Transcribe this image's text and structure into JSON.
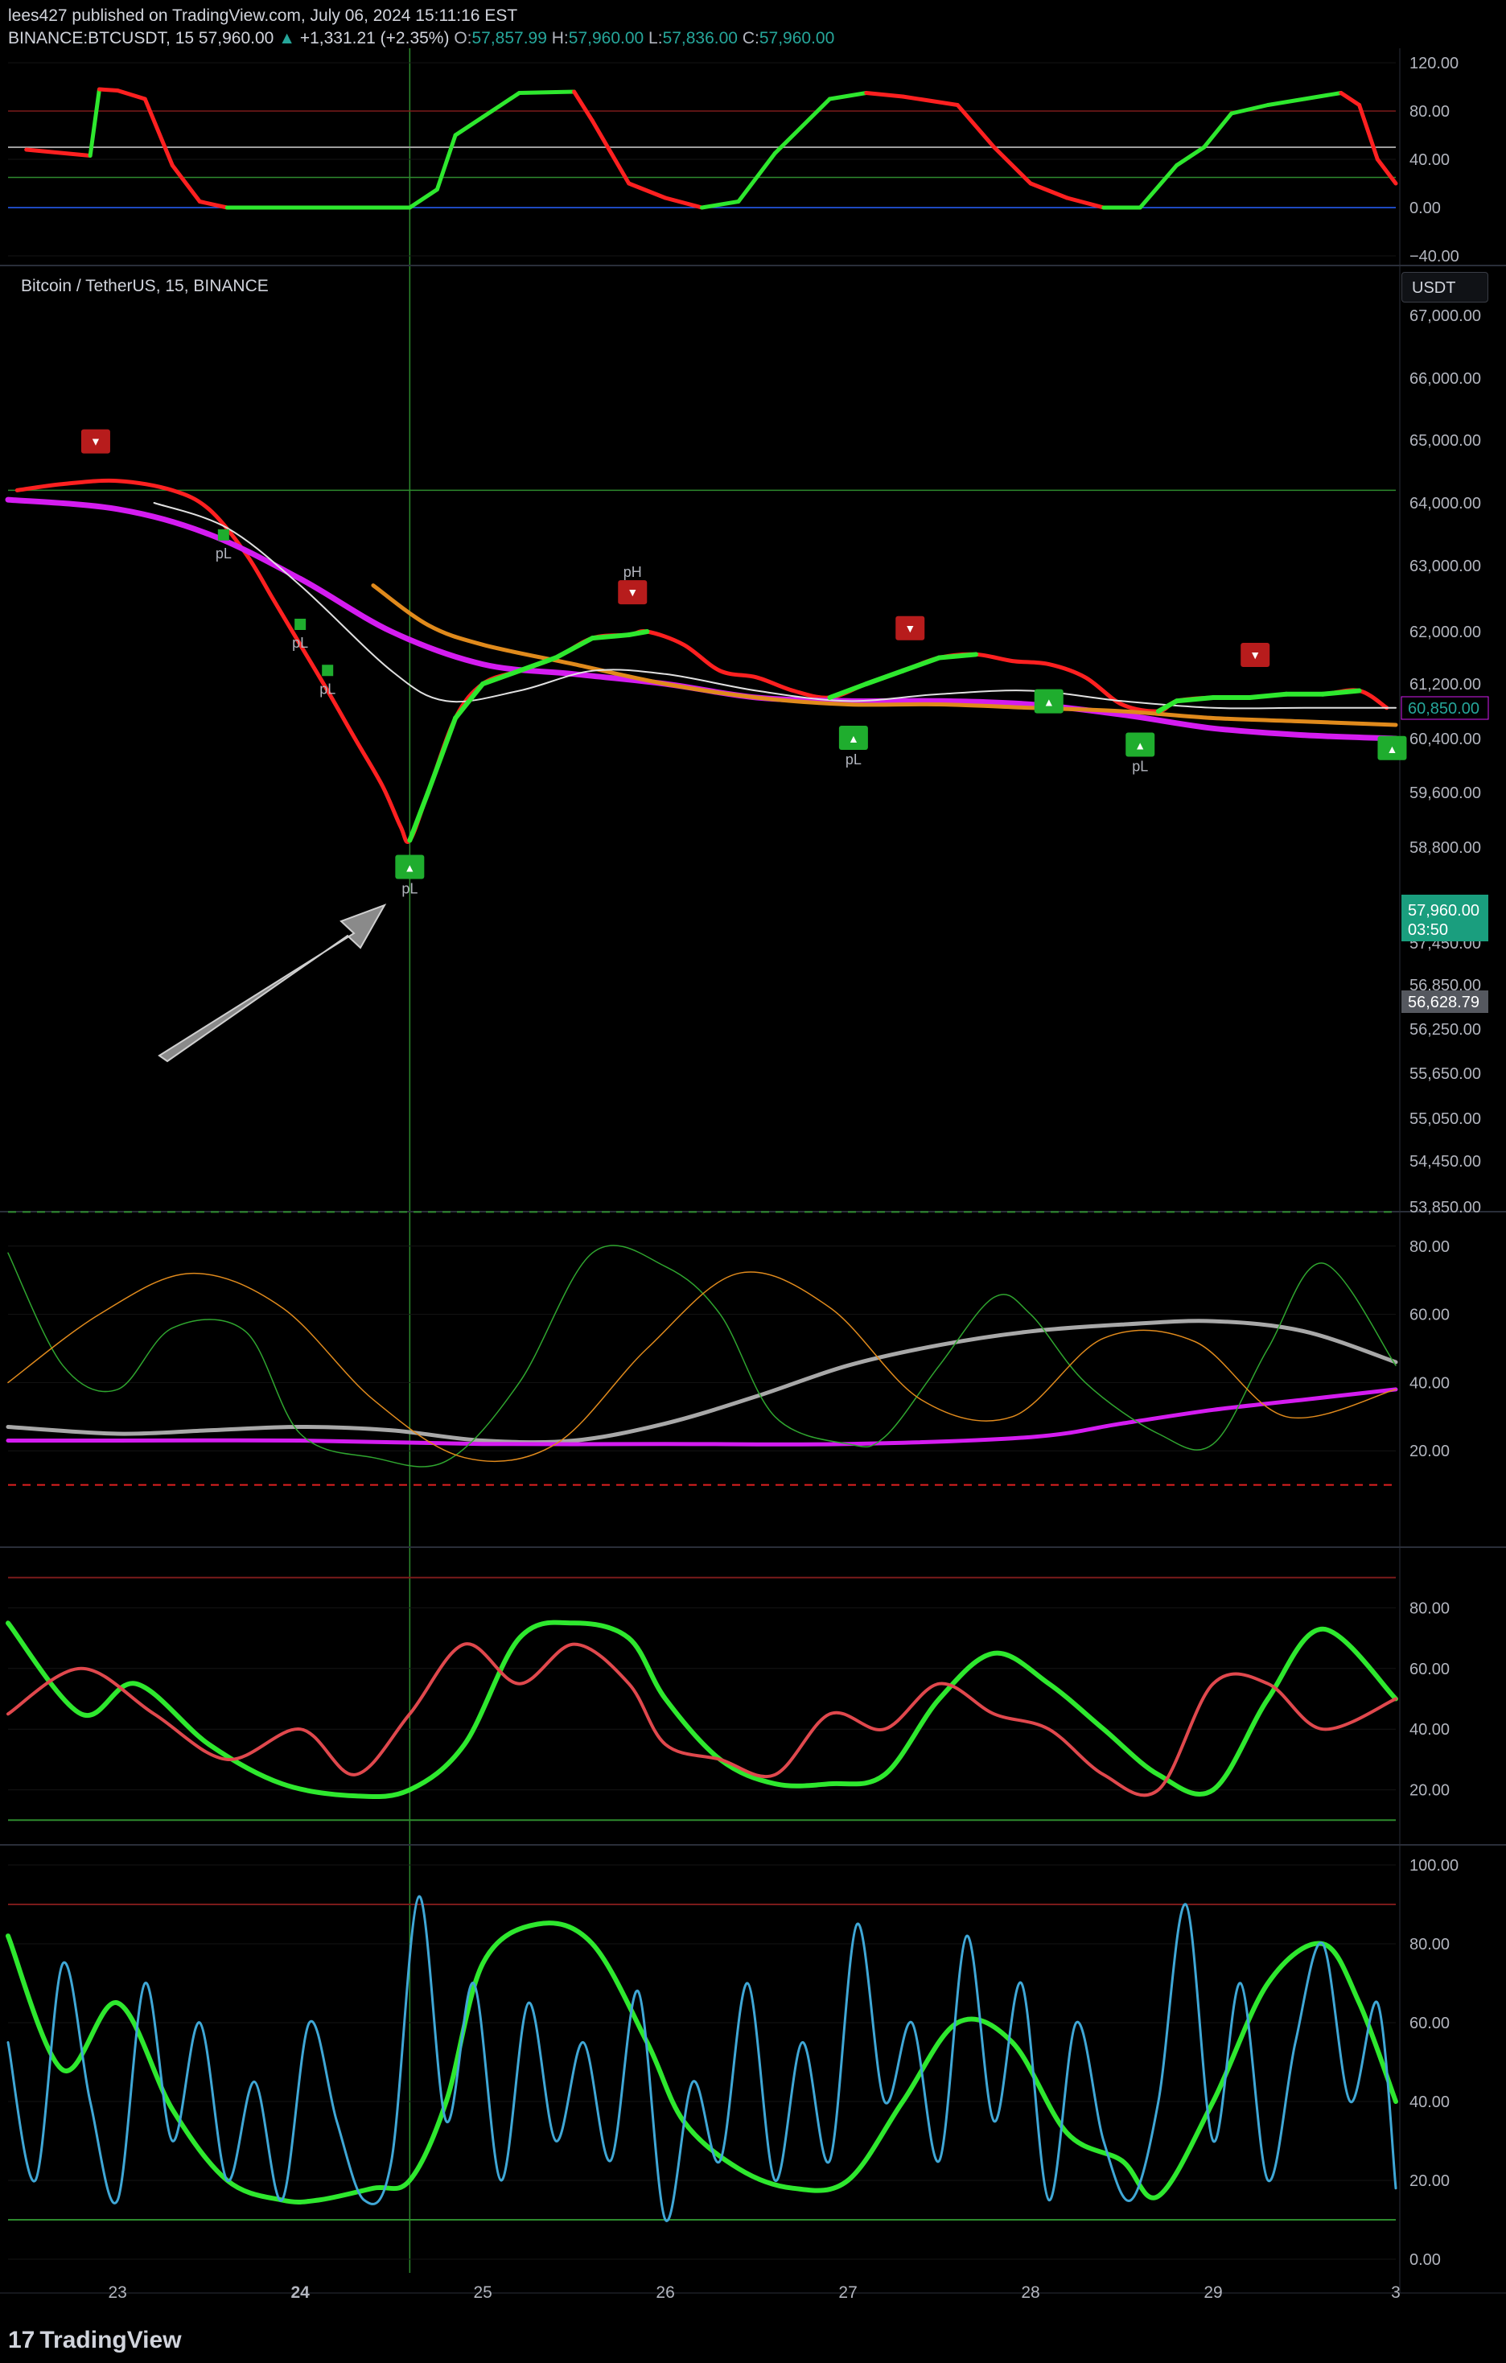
{
  "header": {
    "author": "lees427",
    "published": "published on TradingView.com, July 06, 2024 15:11:16 EST",
    "symbol": "BINANCE:BTCUSDT, 15",
    "last": "57,960.00",
    "change": "+1,331.21 (+2.35%)",
    "o_label": "O:",
    "o": "57,857.99",
    "h_label": "H:",
    "h": "57,960.00",
    "l_label": "L:",
    "l": "57,836.00",
    "c_label": "C:",
    "c": "57,960.00"
  },
  "main_pane": {
    "title": "Bitcoin / TetherUS, 15, BINANCE",
    "currency": "USDT",
    "price_badge": "57,960.00",
    "countdown": "03:50",
    "low_badge": "56,628.79",
    "value_badge": "60,850.00"
  },
  "watermark": "TradingView",
  "colors": {
    "background": "#000000",
    "green": "#2ee82e",
    "red": "#ff2020",
    "magenta": "#d41cf0",
    "orange": "#e08a1c",
    "grey": "#9e9e9e",
    "teal": "#26a69a",
    "marker_red": "#b71c1c",
    "marker_green": "#1fad2e"
  },
  "chart_data": [
    {
      "type": "line",
      "pane": "top-oscillator",
      "y_ticks": [
        "120.00",
        "80.00",
        "40.00",
        "0.00",
        "−40.00"
      ],
      "ylim": [
        -40,
        120
      ],
      "x": [
        22.5,
        22.85,
        22.9,
        23.0,
        23.15,
        23.3,
        23.45,
        23.6,
        23.8,
        24.0,
        24.3,
        24.6,
        24.75,
        24.85,
        25.0,
        25.2,
        25.5,
        25.6,
        25.8,
        26.0,
        26.2,
        26.4,
        26.6,
        26.9,
        27.1,
        27.3,
        27.6,
        27.8,
        28.0,
        28.2,
        28.4,
        28.6,
        28.8,
        28.95,
        29.1,
        29.3,
        29.5,
        29.7,
        29.8,
        29.9,
        30.0
      ],
      "values": [
        48,
        43,
        98,
        97,
        90,
        35,
        5,
        0,
        0,
        0,
        0,
        0,
        15,
        60,
        75,
        95,
        96,
        72,
        20,
        8,
        0,
        5,
        45,
        90,
        95,
        92,
        85,
        50,
        20,
        8,
        0,
        0,
        35,
        50,
        78,
        85,
        90,
        95,
        85,
        40,
        20
      ],
      "levels": [
        80,
        50,
        25,
        0
      ]
    },
    {
      "type": "line",
      "pane": "price",
      "title": "Bitcoin / TetherUS, 15, BINANCE",
      "y_ticks": [
        "67,000.00",
        "66,000.00",
        "65,000.00",
        "64,000.00",
        "63,000.00",
        "62,000.00",
        "61,200.00",
        "60,400.00",
        "59,600.00",
        "58,800.00",
        "57,450.00",
        "56,850.00",
        "56,250.00",
        "55,650.00",
        "55,050.00",
        "54,450.00",
        "53,850.00"
      ],
      "ylim": [
        53700,
        67300
      ],
      "x_ticks": [
        "23",
        "24",
        "25",
        "26",
        "27",
        "28",
        "29",
        "3"
      ],
      "x_tick_values": [
        23,
        24,
        25,
        26,
        27,
        28,
        29,
        30
      ],
      "xlim": [
        22.4,
        30.0
      ],
      "series": [
        {
          "values_kind": "close",
          "x": [
            22.45,
            22.7,
            23.0,
            23.3,
            23.5,
            23.7,
            23.85,
            24.0,
            24.15,
            24.3,
            24.45,
            24.55,
            24.6,
            24.7,
            24.85,
            25.0,
            25.2,
            25.4,
            25.6,
            25.8,
            25.9,
            26.1,
            26.3,
            26.5,
            26.7,
            26.9,
            27.1,
            27.3,
            27.5,
            27.7,
            27.9,
            28.1,
            28.3,
            28.5,
            28.7,
            28.8,
            29.0,
            29.2,
            29.4,
            29.6,
            29.8,
            29.95
          ],
          "values": [
            64200,
            64300,
            64350,
            64200,
            63900,
            63200,
            62500,
            61800,
            61100,
            60400,
            59700,
            59100,
            58900,
            59600,
            60700,
            61200,
            61400,
            61600,
            61900,
            61950,
            62000,
            61800,
            61400,
            61300,
            61100,
            61000,
            61200,
            61400,
            61600,
            61650,
            61550,
            61500,
            61300,
            60900,
            60800,
            60950,
            61000,
            61000,
            61050,
            61050,
            61100,
            60850
          ]
        },
        {
          "values_kind": "magenta-ma",
          "x": [
            22.4,
            23.0,
            23.5,
            24.0,
            24.5,
            25.0,
            25.5,
            26.0,
            26.5,
            27.0,
            27.5,
            28.0,
            28.5,
            29.0,
            29.5,
            30.0
          ],
          "values": [
            64050,
            63900,
            63500,
            62800,
            62000,
            61500,
            61350,
            61200,
            61000,
            60950,
            60950,
            60900,
            60750,
            60550,
            60450,
            60400
          ]
        },
        {
          "values_kind": "orange-ma",
          "x": [
            24.4,
            24.7,
            25.0,
            25.5,
            26.0,
            26.5,
            27.0,
            27.5,
            28.0,
            28.5,
            29.0,
            29.5,
            30.0
          ],
          "values": [
            62700,
            62100,
            61800,
            61500,
            61200,
            61000,
            60900,
            60900,
            60850,
            60800,
            60700,
            60650,
            60600
          ]
        },
        {
          "values_kind": "white-ma",
          "x": [
            23.2,
            23.6,
            24.0,
            24.5,
            24.8,
            25.2,
            25.6,
            26.0,
            26.5,
            27.0,
            27.5,
            28.0,
            28.5,
            29.0,
            29.5,
            30.0
          ],
          "values": [
            64000,
            63600,
            62700,
            61400,
            60950,
            61100,
            61400,
            61350,
            61100,
            60950,
            61050,
            61100,
            60950,
            60850,
            60850,
            60850
          ]
        }
      ],
      "levels": [
        64200
      ],
      "markers": [
        {
          "x": 22.88,
          "type": "sell"
        },
        {
          "x": 23.58,
          "label": "pL"
        },
        {
          "x": 24.0,
          "label": "pL"
        },
        {
          "x": 24.15,
          "label": "pL"
        },
        {
          "x": 24.6,
          "type": "buy",
          "label": "pL"
        },
        {
          "x": 25.82,
          "type": "sell",
          "label": "pH"
        },
        {
          "x": 27.03,
          "type": "buy",
          "label": "pL"
        },
        {
          "x": 27.34,
          "type": "sell"
        },
        {
          "x": 28.1,
          "type": "buy"
        },
        {
          "x": 28.6,
          "type": "buy",
          "label": "pL"
        },
        {
          "x": 29.23,
          "type": "sell"
        },
        {
          "x": 29.98,
          "type": "buy"
        }
      ]
    },
    {
      "type": "line",
      "pane": "oscillator-2",
      "y_ticks": [
        "80.00",
        "60.00",
        "40.00",
        "20.00"
      ],
      "ylim": [
        0,
        100
      ],
      "levels": [
        90,
        10
      ],
      "series": [
        {
          "values_kind": "grey",
          "x": [
            22.4,
            23.0,
            23.5,
            24.0,
            24.5,
            25.0,
            25.5,
            26.0,
            26.5,
            27.0,
            27.5,
            28.0,
            28.5,
            29.0,
            29.5,
            30.0
          ],
          "values": [
            27,
            25,
            26,
            27,
            26,
            23,
            23,
            28,
            36,
            45,
            51,
            55,
            57,
            58,
            55,
            46
          ]
        },
        {
          "values_kind": "magenta",
          "x": [
            22.4,
            23.0,
            24.0,
            25.0,
            26.0,
            27.0,
            28.0,
            28.5,
            29.0,
            29.5,
            30.0
          ],
          "values": [
            23,
            23,
            23,
            22,
            22,
            22,
            24,
            28,
            32,
            35,
            38
          ]
        },
        {
          "values_kind": "green-thin",
          "x": [
            22.4,
            22.7,
            23.0,
            23.3,
            23.7,
            24.0,
            24.4,
            24.8,
            25.2,
            25.6,
            26.0,
            26.3,
            26.6,
            27.0,
            27.2,
            27.5,
            27.8,
            28.0,
            28.3,
            28.7,
            29.0,
            29.3,
            29.6,
            30.0
          ],
          "values": [
            78,
            45,
            38,
            56,
            55,
            25,
            18,
            17,
            40,
            78,
            74,
            60,
            30,
            22,
            24,
            45,
            65,
            60,
            40,
            25,
            22,
            50,
            75,
            45
          ]
        },
        {
          "values_kind": "orange-thin",
          "x": [
            22.4,
            22.9,
            23.4,
            23.9,
            24.4,
            24.9,
            25.4,
            25.9,
            26.4,
            26.9,
            27.4,
            27.9,
            28.4,
            28.9,
            29.4,
            30.0
          ],
          "values": [
            40,
            60,
            72,
            62,
            35,
            18,
            22,
            50,
            72,
            62,
            35,
            30,
            53,
            52,
            30,
            38
          ]
        }
      ]
    },
    {
      "type": "line",
      "pane": "oscillator-3",
      "y_ticks": [
        "80.00",
        "60.00",
        "40.00",
        "20.00"
      ],
      "ylim": [
        0,
        100
      ],
      "levels": [
        90,
        10
      ],
      "series": [
        {
          "values_kind": "green-thick",
          "x": [
            22.4,
            22.8,
            23.1,
            23.5,
            23.9,
            24.3,
            24.6,
            24.9,
            25.2,
            25.5,
            25.8,
            26.0,
            26.3,
            26.6,
            26.9,
            27.2,
            27.5,
            27.8,
            28.1,
            28.4,
            28.7,
            29.0,
            29.3,
            29.6,
            30.0
          ],
          "values": [
            75,
            45,
            55,
            35,
            22,
            18,
            20,
            35,
            70,
            75,
            70,
            50,
            30,
            22,
            22,
            25,
            50,
            65,
            55,
            40,
            25,
            20,
            50,
            73,
            50
          ]
        },
        {
          "values_kind": "red",
          "x": [
            22.4,
            22.8,
            23.2,
            23.6,
            24.0,
            24.3,
            24.6,
            24.9,
            25.2,
            25.5,
            25.8,
            26.0,
            26.3,
            26.6,
            26.9,
            27.2,
            27.5,
            27.8,
            28.1,
            28.4,
            28.7,
            29.0,
            29.3,
            29.6,
            30.0
          ],
          "values": [
            45,
            60,
            45,
            30,
            40,
            25,
            45,
            68,
            55,
            68,
            55,
            35,
            30,
            25,
            45,
            40,
            55,
            45,
            40,
            25,
            20,
            55,
            55,
            40,
            50
          ]
        }
      ]
    },
    {
      "type": "line",
      "pane": "oscillator-4",
      "y_ticks": [
        "100.00",
        "80.00",
        "60.00",
        "40.00",
        "20.00",
        "0.00"
      ],
      "ylim": [
        -5,
        105
      ],
      "levels": [
        90,
        10
      ],
      "series": [
        {
          "values_kind": "green-thick",
          "x": [
            22.4,
            22.7,
            23.0,
            23.3,
            23.6,
            23.9,
            24.1,
            24.4,
            24.6,
            24.8,
            25.0,
            25.3,
            25.6,
            25.9,
            26.1,
            26.4,
            26.7,
            27.0,
            27.3,
            27.6,
            27.9,
            28.2,
            28.5,
            28.7,
            29.0,
            29.3,
            29.6,
            29.8,
            30.0
          ],
          "values": [
            82,
            48,
            65,
            38,
            20,
            15,
            15,
            18,
            20,
            40,
            75,
            85,
            80,
            55,
            35,
            23,
            18,
            20,
            40,
            60,
            55,
            32,
            25,
            16,
            40,
            70,
            80,
            65,
            40
          ]
        },
        {
          "values_kind": "oscillating-fast",
          "x": [
            22.4,
            22.55,
            22.7,
            22.85,
            23.0,
            23.15,
            23.3,
            23.45,
            23.6,
            23.75,
            23.9,
            24.05,
            24.2,
            24.35,
            24.5,
            24.65,
            24.8,
            24.95,
            25.1,
            25.25,
            25.4,
            25.55,
            25.7,
            25.85,
            26.0,
            26.15,
            26.3,
            26.45,
            26.6,
            26.75,
            26.9,
            27.05,
            27.2,
            27.35,
            27.5,
            27.65,
            27.8,
            27.95,
            28.1,
            28.25,
            28.4,
            28.55,
            28.7,
            28.85,
            29.0,
            29.15,
            29.3,
            29.45,
            29.6,
            29.75,
            29.9,
            30.0
          ],
          "values": [
            55,
            20,
            75,
            40,
            15,
            70,
            30,
            60,
            20,
            45,
            15,
            60,
            35,
            15,
            25,
            92,
            35,
            70,
            20,
            65,
            30,
            55,
            25,
            68,
            10,
            45,
            25,
            70,
            20,
            55,
            25,
            85,
            40,
            60,
            25,
            82,
            35,
            70,
            15,
            60,
            30,
            15,
            40,
            90,
            30,
            70,
            20,
            55,
            80,
            40,
            65,
            18
          ]
        }
      ]
    }
  ]
}
